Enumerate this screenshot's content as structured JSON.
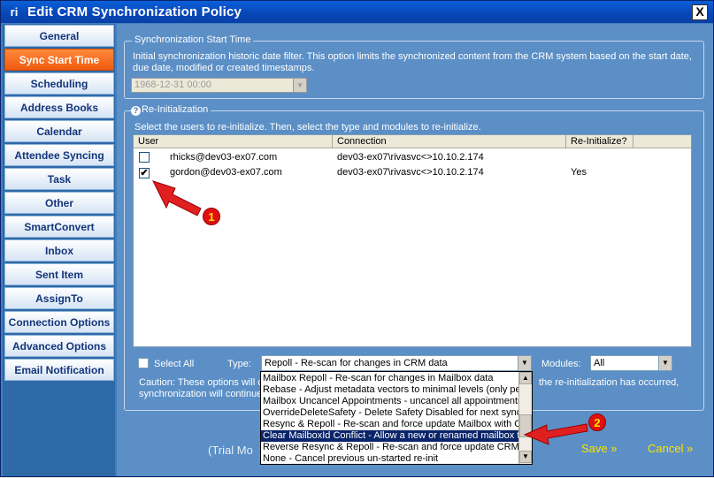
{
  "window": {
    "title": "Edit CRM Synchronization Policy",
    "logo": "ri",
    "close": "X"
  },
  "sidebar": {
    "items": [
      {
        "label": "General"
      },
      {
        "label": "Sync Start Time"
      },
      {
        "label": "Scheduling"
      },
      {
        "label": "Address Books"
      },
      {
        "label": "Calendar"
      },
      {
        "label": "Attendee Syncing"
      },
      {
        "label": "Task"
      },
      {
        "label": "Other"
      },
      {
        "label": "SmartConvert"
      },
      {
        "label": "Inbox"
      },
      {
        "label": "Sent Item"
      },
      {
        "label": "AssignTo"
      },
      {
        "label": "Connection Options"
      },
      {
        "label": "Advanced Options"
      },
      {
        "label": "Email Notification"
      }
    ]
  },
  "sync_start": {
    "legend": "Synchronization Start Time",
    "description_line1": "Initial synchronization historic date filter.  This option limits the synchronized content from the CRM system based on the start date,",
    "description_line2": "due date, modified or created timestamps.",
    "date_value": "1968-12-31 00:00"
  },
  "reinit": {
    "legend": "Re-Initialization",
    "instructions": "Select the users to re-initialize.  Then, select the type and modules to re-initialize.",
    "columns": [
      "User",
      "Connection",
      "Re-Initialize?"
    ],
    "rows": [
      {
        "user": "rhicks@dev03-ex07.com",
        "connection": "dev03-ex07\\rivasvc<>10.10.2.174",
        "reinit": "",
        "checked": ""
      },
      {
        "user": "gordon@dev03-ex07.com",
        "connection": "dev03-ex07\\rivasvc<>10.10.2.174",
        "reinit": "Yes",
        "checked": "✔"
      }
    ],
    "select_all_label": "Select All",
    "type_label": "Type:",
    "type_value": "Repoll - Re-scan for changes in CRM data",
    "modules_label": "Modules:",
    "modules_value": "All",
    "caution_left": "Caution: These options will c",
    "caution_right": "the re-initialization has occurred,",
    "caution_line2": "synchronization will continue"
  },
  "dropdown_options": [
    "Mailbox Repoll - Re-scan for changes in Mailbox data",
    "Rebase - Adjust metadata vectors to minimal levels (only per",
    "Mailbox Uncancel Appointments - uncancel all appointments i",
    "OverrideDeleteSafety - Delete Safety Disabled for next sync",
    "Resync & Repoll - Re-scan and force update Mailbox with CR",
    "Clear MailboxId Conflict - Allow a new or renamed mailbox to",
    "Reverse Resync & Repoll - Re-scan and force update CRM w",
    "None - Cancel previous un-started re-init"
  ],
  "footer": {
    "trial": "(Trial Mo",
    "save": "Save »",
    "cancel": "Cancel »"
  },
  "annotations": {
    "badge1": "1",
    "badge2": "2"
  },
  "colors": {
    "active_nav": "#F26B1D",
    "selection": "#0A246A",
    "panel": "#5B8FC6",
    "save_link": "#FFE400",
    "cancel_link": "#FFE400"
  }
}
